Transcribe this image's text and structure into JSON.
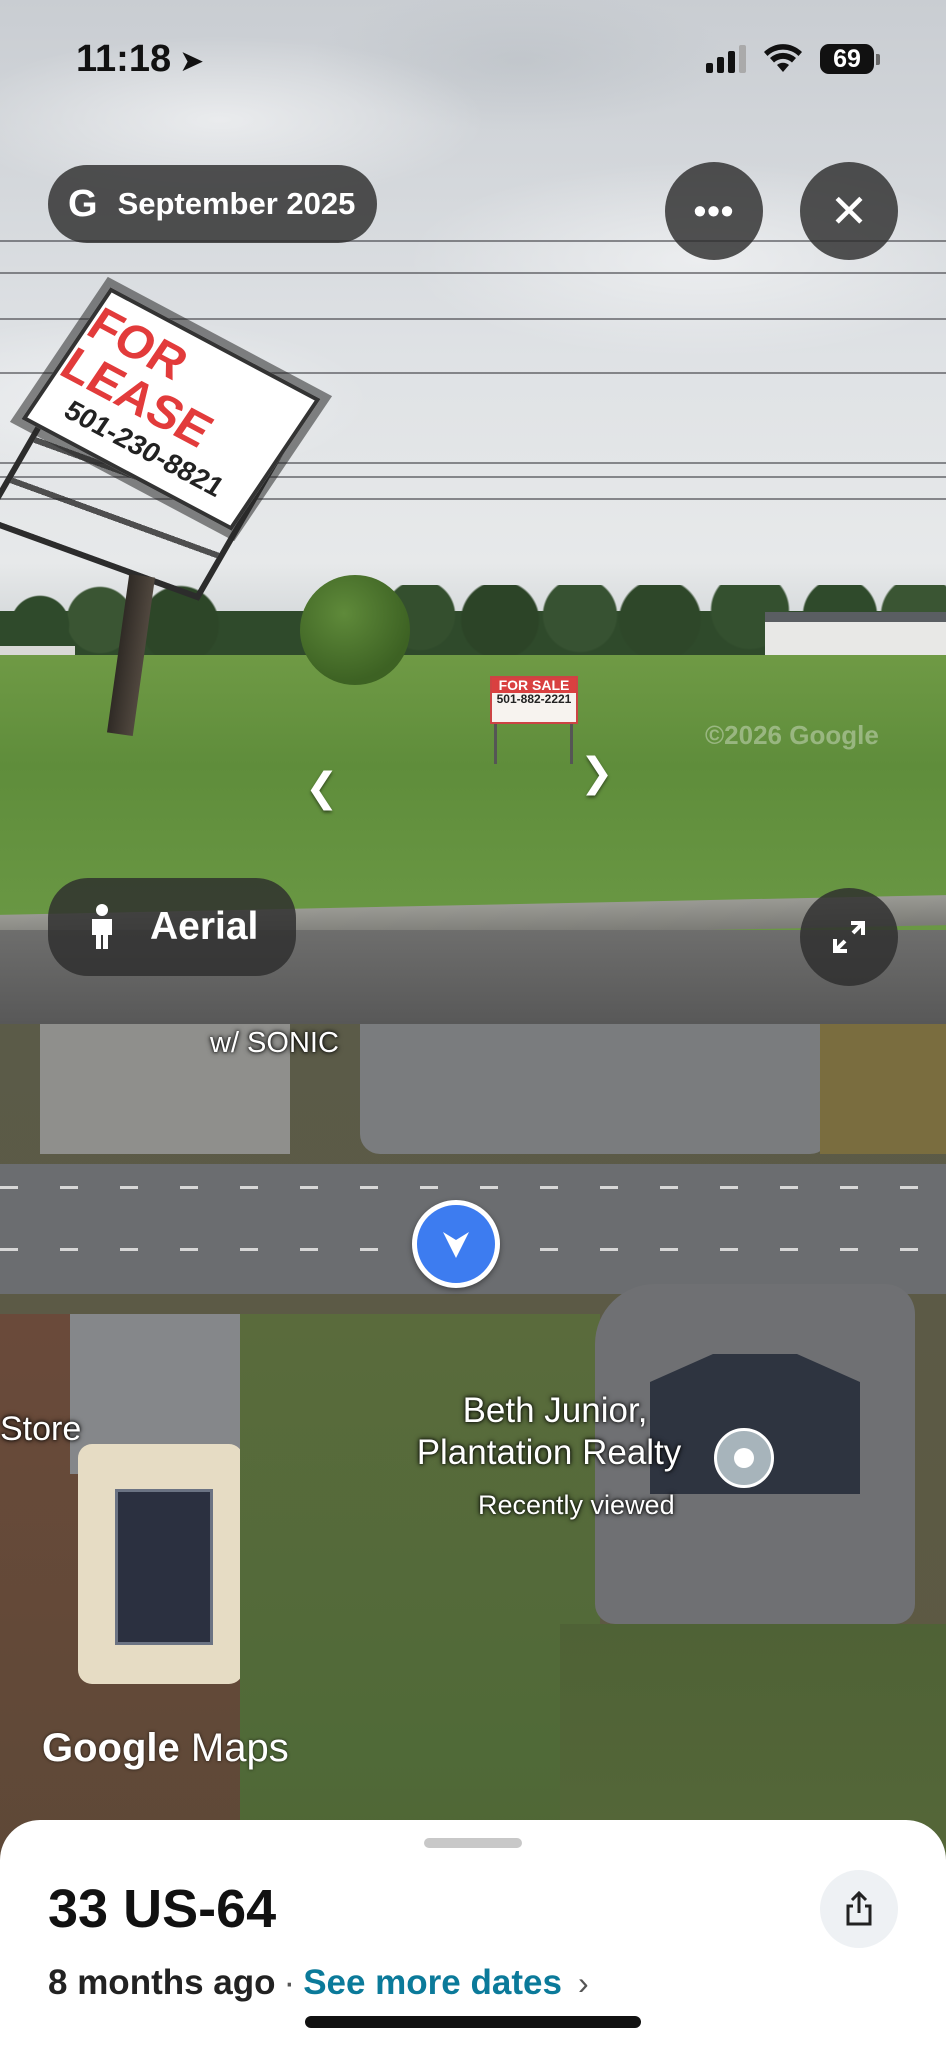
{
  "status_bar": {
    "time": "11:18",
    "battery": "69"
  },
  "streetview": {
    "date_label": "September 2025",
    "mode_label": "Aerial",
    "billboard_top": "FOR LEASE",
    "billboard_phone": "501-230-8821",
    "sale_sign_top": "FOR SALE",
    "sale_sign_phone": "501-882-2221",
    "watermark": "©2026 Google"
  },
  "map": {
    "label_sonic": "w/ SONIC",
    "label_store": "Store",
    "place_name_line1": "Beth Junior,",
    "place_name_line2": "Plantation Realty",
    "place_status": "Recently viewed",
    "logo_google": "Google",
    "logo_maps": "Maps",
    "route_color": "#27a3e8"
  },
  "sheet": {
    "title": "33 US-64",
    "age": "8 months ago",
    "separator": "·",
    "see_more": "See more dates"
  },
  "icons": {
    "location_arrow": "location-arrow-icon",
    "wifi": "wifi-icon",
    "google_g": "google-g-icon",
    "more": "more-icon",
    "close": "close-icon",
    "pegman": "pegman-icon",
    "expand": "expand-icon",
    "share": "share-icon",
    "chevron": "chevron-right-icon"
  }
}
